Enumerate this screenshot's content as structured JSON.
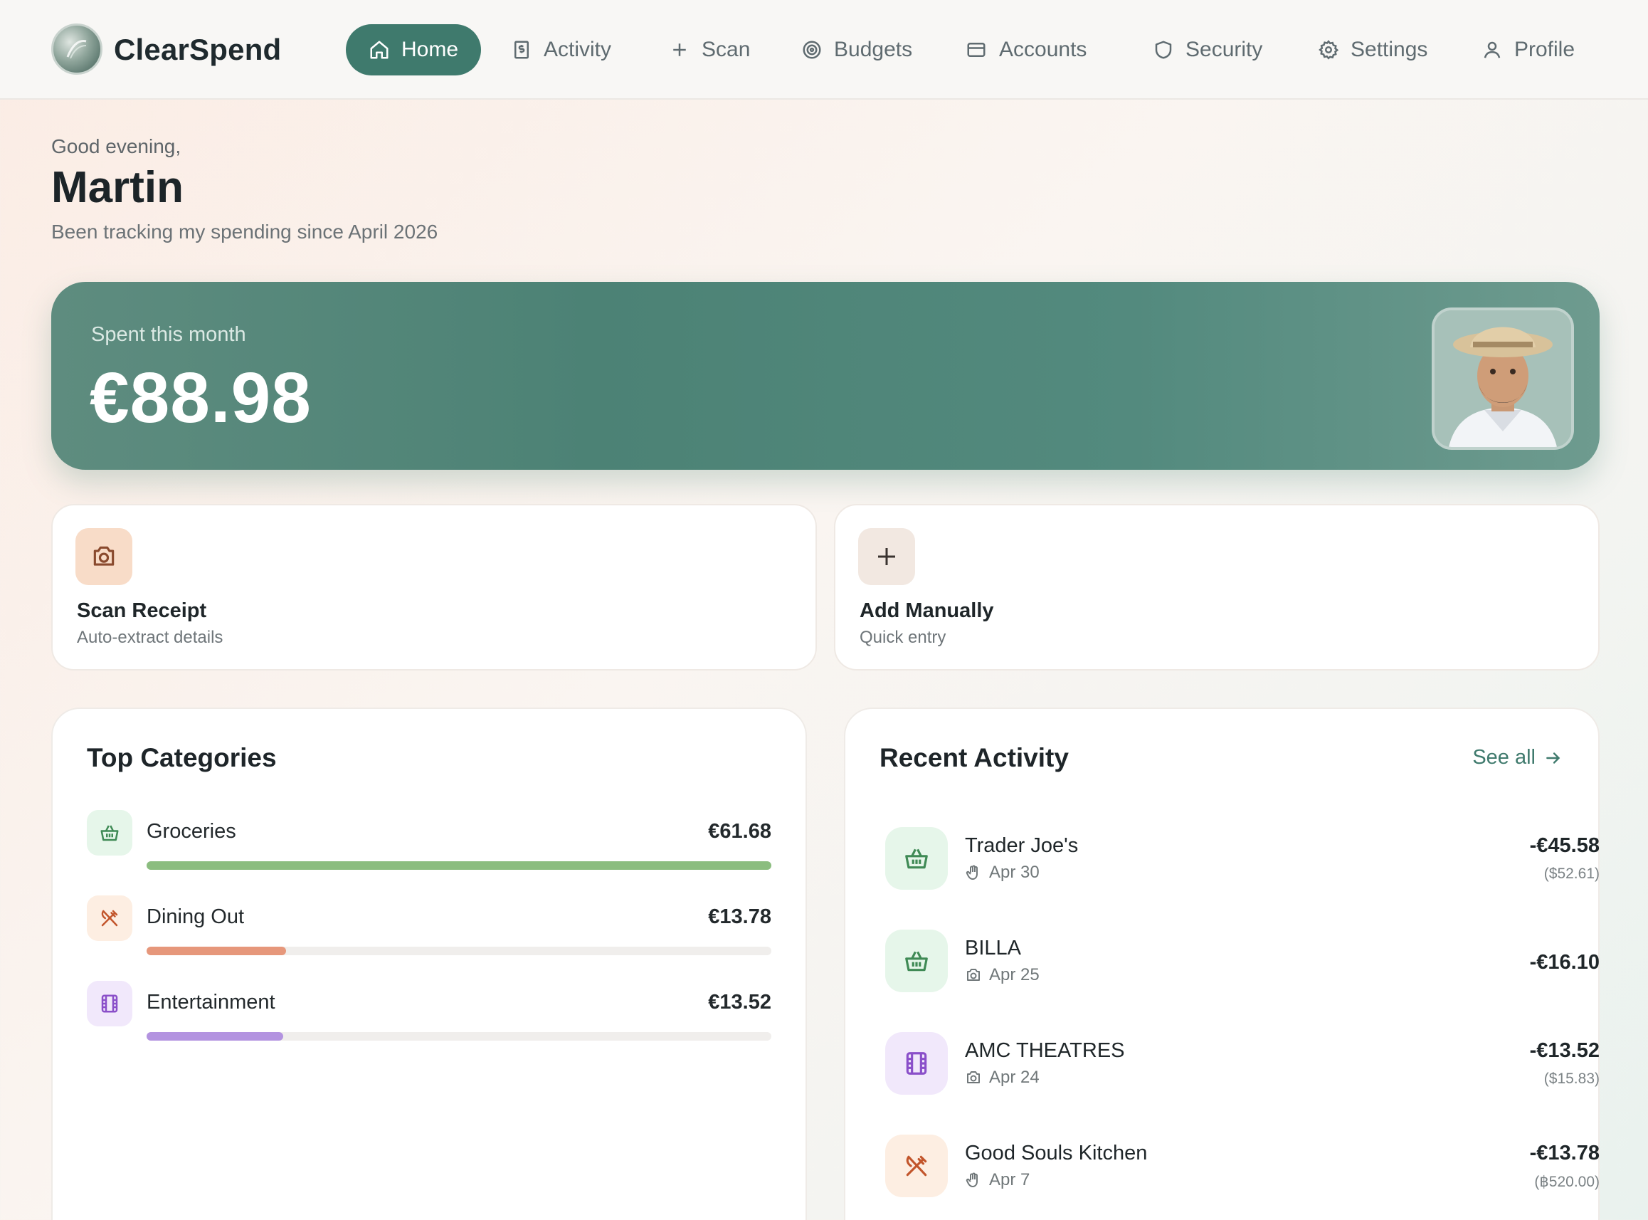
{
  "app": {
    "name": "ClearSpend"
  },
  "nav": {
    "home": "Home",
    "activity": "Activity",
    "scan": "Scan",
    "budgets": "Budgets",
    "accounts": "Accounts",
    "security": "Security",
    "settings": "Settings",
    "profile": "Profile"
  },
  "greeting": {
    "salutation": "Good evening,",
    "name": "Martin",
    "subtitle": "Been tracking my spending since April 2026"
  },
  "summary": {
    "label": "Spent this month",
    "amount": "€88.98"
  },
  "actions": {
    "scan": {
      "title": "Scan Receipt",
      "subtitle": "Auto-extract details",
      "icon": "camera-icon"
    },
    "manual": {
      "title": "Add Manually",
      "subtitle": "Quick entry",
      "icon": "plus-icon"
    }
  },
  "categories": {
    "title": "Top Categories",
    "items": [
      {
        "name": "Groceries",
        "amount": "€61.68",
        "fraction": 1.0,
        "color": "#8bbd7f",
        "icon": "basket-icon",
        "icon_bg": "#e6f6ea",
        "icon_color": "#3f8a55"
      },
      {
        "name": "Dining Out",
        "amount": "€13.78",
        "fraction": 0.223,
        "color": "#e6977b",
        "icon": "utensils-crossed-icon",
        "icon_bg": "#fdeee2",
        "icon_color": "#c2552b"
      },
      {
        "name": "Entertainment",
        "amount": "€13.52",
        "fraction": 0.219,
        "color": "#b393e0",
        "icon": "film-icon",
        "icon_bg": "#f1e8fb",
        "icon_color": "#8a4fc9"
      }
    ]
  },
  "activity": {
    "title": "Recent Activity",
    "see_all": "See all",
    "items": [
      {
        "merchant": "Trader Joe's",
        "date": "Apr 30",
        "source": "hand-icon",
        "amount": "-€45.58",
        "original": "($52.61)",
        "icon": "basket-icon",
        "icon_bg": "#e6f6ea",
        "icon_color": "#3f8a55"
      },
      {
        "merchant": "BILLA",
        "date": "Apr 25",
        "source": "camera-icon",
        "amount": "-€16.10",
        "original": "",
        "icon": "basket-icon",
        "icon_bg": "#e6f6ea",
        "icon_color": "#3f8a55"
      },
      {
        "merchant": "AMC THEATRES",
        "date": "Apr 24",
        "source": "camera-icon",
        "amount": "-€13.52",
        "original": "($15.83)",
        "icon": "film-icon",
        "icon_bg": "#f1e8fb",
        "icon_color": "#8a4fc9"
      },
      {
        "merchant": "Good Souls Kitchen",
        "date": "Apr 7",
        "source": "hand-icon",
        "amount": "-€13.78",
        "original": "(฿520.00)",
        "icon": "utensils-crossed-icon",
        "icon_bg": "#fdeee2",
        "icon_color": "#c2552b"
      }
    ]
  },
  "colors": {
    "accent": "#3f7a6d",
    "hero": "#4c8275"
  }
}
